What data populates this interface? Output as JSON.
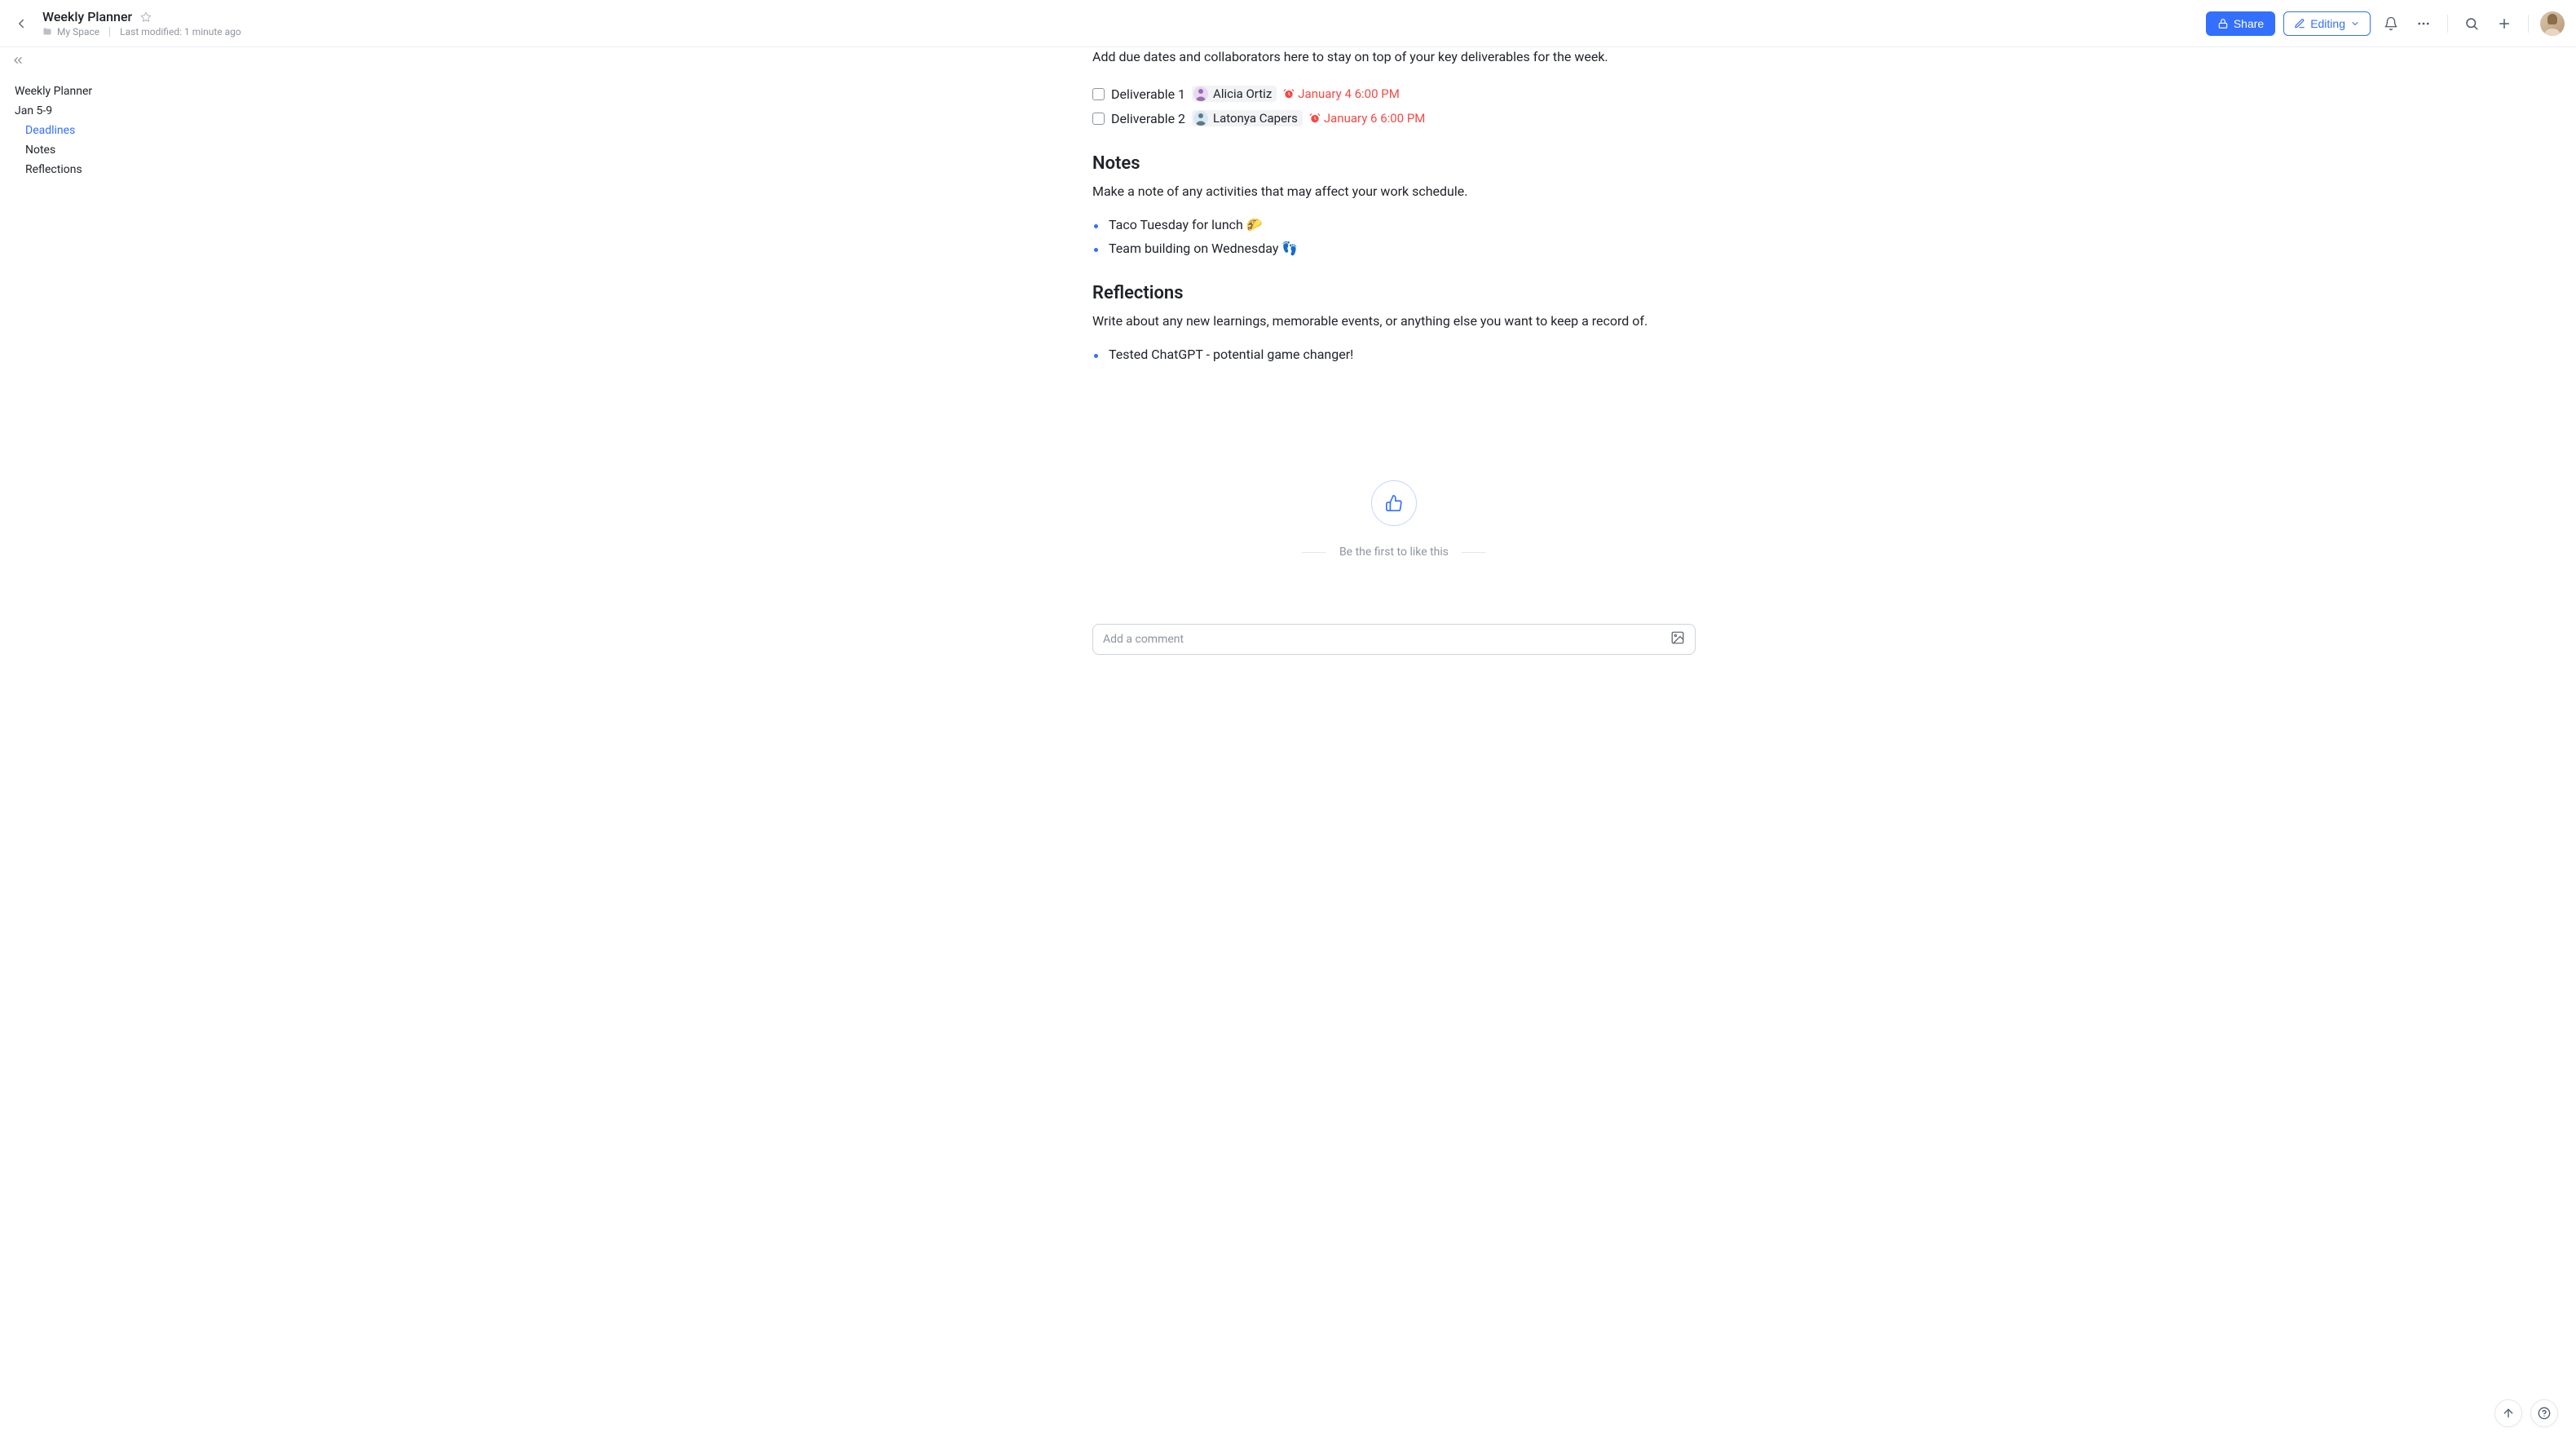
{
  "header": {
    "title": "Weekly Planner",
    "space": "My Space",
    "modified": "Last modified: 1 minute ago",
    "share": "Share",
    "editing": "Editing"
  },
  "sidebar": {
    "title": "Weekly Planner",
    "items": [
      {
        "label": "Jan 5-9",
        "level": 1,
        "active": false
      },
      {
        "label": "Deadlines",
        "level": 2,
        "active": true
      },
      {
        "label": "Notes",
        "level": 2,
        "active": false
      },
      {
        "label": "Reflections",
        "level": 2,
        "active": false
      }
    ]
  },
  "doc": {
    "deadlines_intro": "Add due dates and collaborators here to stay on top of your key deliverables for the week.",
    "tasks": [
      {
        "title": "Deliverable 1",
        "assignee": "Alicia Ortiz",
        "due": "January 4 6:00 PM"
      },
      {
        "title": "Deliverable 2",
        "assignee": "Latonya Capers",
        "due": "January 6 6:00 PM"
      }
    ],
    "notes_heading": "Notes",
    "notes_desc": "Make a note of any activities that may affect your work schedule.",
    "notes": [
      "Taco Tuesday for lunch 🌮",
      "Team building on Wednesday 👣"
    ],
    "reflections_heading": "Reflections",
    "reflections_desc": "Write about any new learnings, memorable events, or anything else you want to keep a record of.",
    "reflections": [
      "Tested ChatGPT - potential game changer!"
    ]
  },
  "like": {
    "caption": "Be the first to like this"
  },
  "comment": {
    "placeholder": "Add a comment"
  }
}
